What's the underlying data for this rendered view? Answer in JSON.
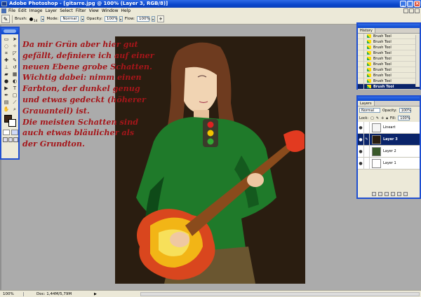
{
  "window": {
    "title": "Adobe Photoshop - [gitarre.jpg @ 100% (Layer 3, RGB/8)]",
    "min": "_",
    "max": "□",
    "close": "×"
  },
  "menu": [
    "File",
    "Edit",
    "Image",
    "Layer",
    "Select",
    "Filter",
    "View",
    "Window",
    "Help"
  ],
  "options": {
    "brush_label": "Brush:",
    "brush_size": "14",
    "mode_label": "Mode:",
    "mode_value": "Normal",
    "opacity_label": "Opacity:",
    "opacity_value": "100%",
    "flow_label": "Flow:",
    "flow_value": "100%"
  },
  "annotation": [
    "Da mir Grün aber hier gut",
    "gefällt, definiere ich auf einer",
    "neuen Ebene grobe Schatten.",
    "Wichtig dabei: nimm einen",
    "Farbton, der dunkel genug",
    "und etwas gedeckt (höherer",
    "Grauanteil) ist.",
    "Die meisten Schatten sind",
    "auch etwas bläulicher als",
    "der Grundton."
  ],
  "history": {
    "tab": "History",
    "items": [
      "Brush Tool",
      "Brush Tool",
      "Brush Tool",
      "Brush Tool",
      "Brush Tool",
      "Brush Tool",
      "Brush Tool",
      "Brush Tool",
      "Brush Tool",
      "Brush Tool"
    ],
    "active_index": 9
  },
  "layers": {
    "tab": "Layers",
    "mode": "Normal",
    "opacity_label": "Opacity:",
    "opacity": "100%",
    "lock_label": "Lock:",
    "fill_label": "Fill:",
    "fill": "100%",
    "items": [
      {
        "name": "Lineart"
      },
      {
        "name": "Layer 3"
      },
      {
        "name": "Layer 2"
      },
      {
        "name": "Layer 1"
      }
    ],
    "active_index": 1
  },
  "status": {
    "zoom": "100%",
    "doc": "Doc: 1,44M/5,79M"
  },
  "colors": {
    "annotation": "#a5161a",
    "foreground_swatch": "#3b2414",
    "background_swatch": "#ffffff"
  }
}
